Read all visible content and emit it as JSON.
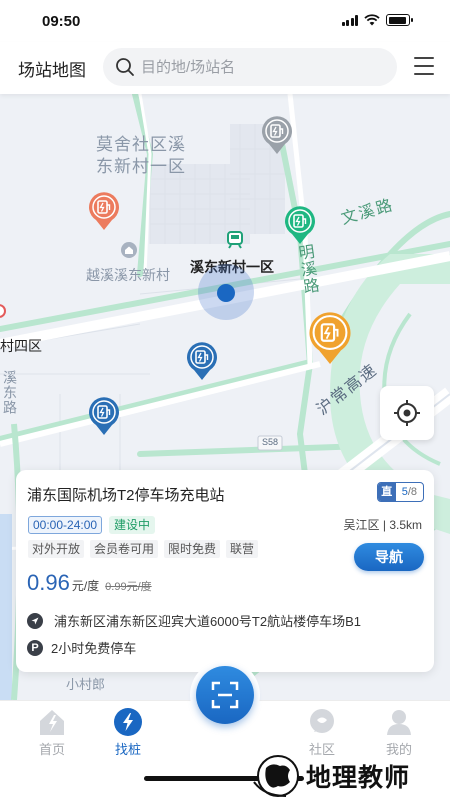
{
  "status_bar": {
    "time": "09:50"
  },
  "header": {
    "title": "场站地图",
    "search_placeholder": "目的地/场站名"
  },
  "map": {
    "labels": {
      "community": "莫舍社区溪东新村一区",
      "community_line1": "莫舍社区溪",
      "community_line2": "东新村一区",
      "village": "越溪溪东新村",
      "station": "溪东新村一区",
      "road_wenxi": "文溪路",
      "road_mingxi": "明溪路",
      "road_hushang": "沪常高速",
      "village4": "村四区",
      "xidong": "溪东路",
      "village_small": "小村郎",
      "road_number": "S58"
    },
    "pin_colors": {
      "gray": "#9aa1a9",
      "orange_red": "#ec7b5e",
      "green": "#1fb782",
      "orange": "#f0a22e",
      "blue": "#2a6fb5"
    }
  },
  "station": {
    "name": "浦东国际机场T2停车场充电站",
    "pile_type": "直",
    "pile_available": "5",
    "pile_total": "/8",
    "hours": "00:00-24:00",
    "status": "建设中",
    "district": "吴江区",
    "distance": "3.5km",
    "location_text": "吴江区 | 3.5km",
    "tags": [
      "对外开放",
      "会员卷可用",
      "限时免费",
      "联营"
    ],
    "nav_label": "导航",
    "price": "0.96",
    "price_unit": "元/度",
    "price_old": "0.99元/度",
    "address": "浦东新区浦东新区迎宾大道6000号T2航站楼停车场B1",
    "parking": "2小时免费停车",
    "parking_icon_label": "P"
  },
  "bottom_nav": {
    "items": [
      {
        "label": "首页",
        "icon": "home-icon",
        "active": false
      },
      {
        "label": "找桩",
        "icon": "lightning-icon",
        "active": true
      },
      {
        "label": "社区",
        "icon": "chat-icon",
        "active": false
      },
      {
        "label": "我的",
        "icon": "user-icon",
        "active": false
      }
    ],
    "scan_icon": "scan-icon"
  },
  "watermark": {
    "text": "地理教师"
  },
  "colors": {
    "accent": "#1a67c2",
    "map_bg": "#eef1f6",
    "road_green": "#b9e6cf",
    "status_green": "#1f9d66"
  }
}
